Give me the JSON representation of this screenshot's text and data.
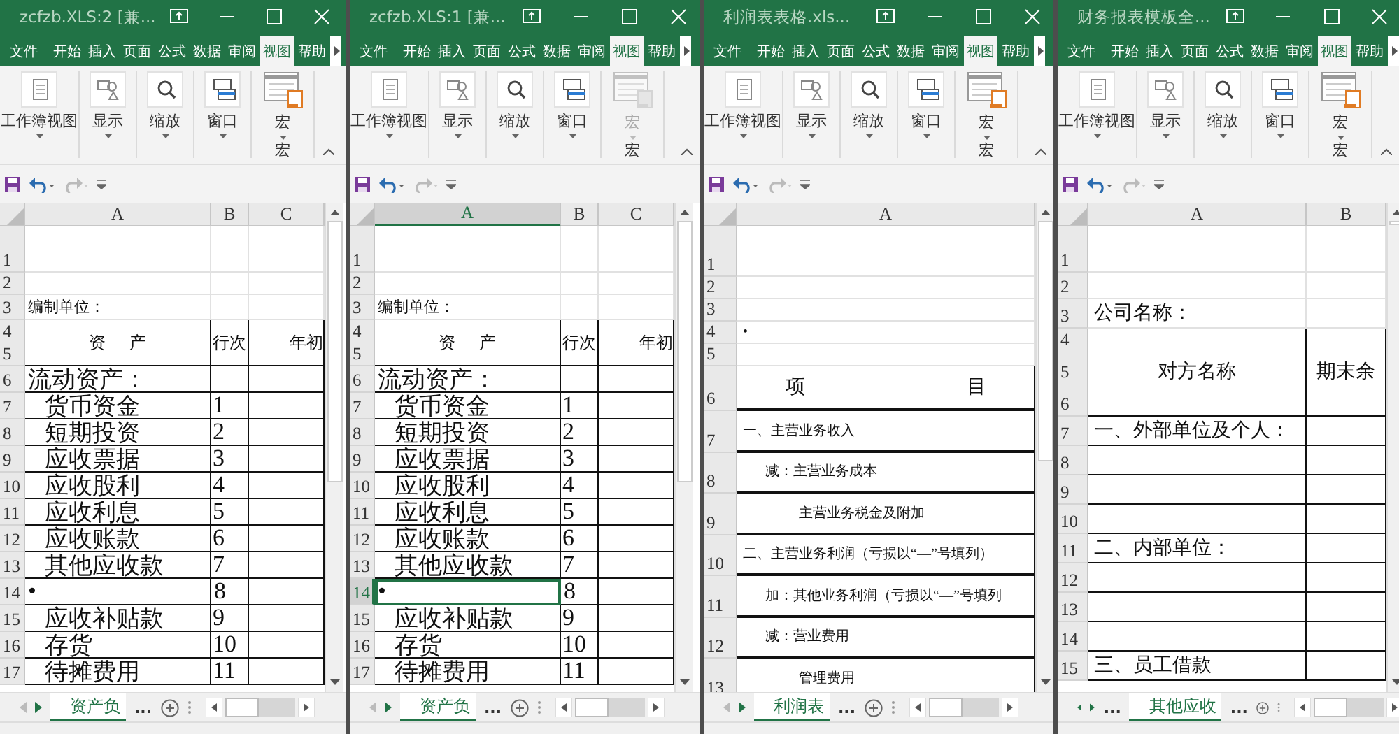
{
  "windows": [
    {
      "title": "zcfzb.XLS:2 [兼...",
      "ribbon_tabs": [
        {
          "label": "文件",
          "selected": false
        },
        {
          "label": "开始",
          "selected": false
        },
        {
          "label": "插入",
          "selected": false
        },
        {
          "label": "页面",
          "selected": false
        },
        {
          "label": "公式",
          "selected": false
        },
        {
          "label": "数据",
          "selected": false
        },
        {
          "label": "审阅",
          "selected": false
        },
        {
          "label": "视图",
          "selected": true
        },
        {
          "label": "帮助",
          "selected": false
        }
      ],
      "ribbon_groups": [
        {
          "label": "工作簿视图",
          "disabled": false
        },
        {
          "label": "显示",
          "disabled": false
        },
        {
          "label": "缩放",
          "disabled": false
        },
        {
          "label": "窗口",
          "disabled": false
        },
        {
          "label": "宏",
          "group_label": "宏",
          "disabled": false
        }
      ],
      "columns": [
        {
          "label": "A",
          "selected": false
        },
        {
          "label": "B",
          "selected": false
        },
        {
          "label": "C",
          "selected": false
        }
      ],
      "rows": [
        {
          "numbers": [
            "1"
          ],
          "kind": "blank",
          "boxed": false,
          "selected": false
        },
        {
          "numbers": [
            "2"
          ],
          "kind": "blank",
          "boxed": false,
          "selected": false
        },
        {
          "numbers": [
            "3"
          ],
          "kind": "note",
          "boxed": false,
          "selected": false,
          "cells": [
            "编制单位："
          ]
        },
        {
          "numbers": [
            "4",
            "5"
          ],
          "kind": "header",
          "boxed": true,
          "selected": false,
          "cells": [
            "资 产",
            "行次",
            "年初"
          ]
        },
        {
          "numbers": [
            "6"
          ],
          "kind": "plain",
          "boxed": true,
          "selected": false,
          "cells": [
            "流动资产："
          ]
        },
        {
          "numbers": [
            "7"
          ],
          "kind": "indent",
          "boxed": true,
          "selected": false,
          "cells": [
            "货币资金",
            "1"
          ]
        },
        {
          "numbers": [
            "8"
          ],
          "kind": "indent",
          "boxed": true,
          "selected": false,
          "cells": [
            "短期投资",
            "2"
          ]
        },
        {
          "numbers": [
            "9"
          ],
          "kind": "indent",
          "boxed": true,
          "selected": false,
          "cells": [
            "应收票据",
            "3"
          ]
        },
        {
          "numbers": [
            "10"
          ],
          "kind": "indent",
          "boxed": true,
          "selected": false,
          "cells": [
            "应收股利",
            "4"
          ]
        },
        {
          "numbers": [
            "11"
          ],
          "kind": "indent",
          "boxed": true,
          "selected": false,
          "cells": [
            "应收利息",
            "5"
          ]
        },
        {
          "numbers": [
            "12"
          ],
          "kind": "indent",
          "boxed": true,
          "selected": false,
          "cells": [
            "应收账款",
            "6"
          ]
        },
        {
          "numbers": [
            "13"
          ],
          "kind": "indent",
          "boxed": true,
          "selected": false,
          "cells": [
            "其他应收款",
            "7"
          ]
        },
        {
          "numbers": [
            "14"
          ],
          "kind": "plain",
          "boxed": true,
          "selected": false,
          "cells": [
            "•",
            "8"
          ]
        },
        {
          "numbers": [
            "15"
          ],
          "kind": "indent",
          "boxed": true,
          "selected": false,
          "cells": [
            "应收补贴款",
            "9"
          ]
        },
        {
          "numbers": [
            "16"
          ],
          "kind": "indent",
          "boxed": true,
          "selected": false,
          "cells": [
            "存货",
            "10"
          ]
        },
        {
          "numbers": [
            "17"
          ],
          "kind": "indent",
          "boxed": true,
          "selected": false,
          "cells": [
            "待摊费用",
            "11"
          ]
        }
      ],
      "sheet_bar": {
        "first_enabled": false,
        "items": [
          {
            "kind": "tab",
            "label": "资产负",
            "selected": true
          },
          {
            "kind": "more",
            "label": "..."
          }
        ]
      }
    },
    {
      "title": "zcfzb.XLS:1 [兼...",
      "ribbon_tabs": [
        {
          "label": "文件",
          "selected": false
        },
        {
          "label": "开始",
          "selected": false
        },
        {
          "label": "插入",
          "selected": false
        },
        {
          "label": "页面",
          "selected": false
        },
        {
          "label": "公式",
          "selected": false
        },
        {
          "label": "数据",
          "selected": false
        },
        {
          "label": "审阅",
          "selected": false
        },
        {
          "label": "视图",
          "selected": true
        },
        {
          "label": "帮助",
          "selected": false
        }
      ],
      "ribbon_groups": [
        {
          "label": "工作簿视图",
          "disabled": false
        },
        {
          "label": "显示",
          "disabled": false
        },
        {
          "label": "缩放",
          "disabled": false
        },
        {
          "label": "窗口",
          "disabled": false
        },
        {
          "label": "宏",
          "group_label": "宏",
          "disabled": true
        }
      ],
      "columns": [
        {
          "label": "A",
          "selected": true
        },
        {
          "label": "B",
          "selected": false
        },
        {
          "label": "C",
          "selected": false
        }
      ],
      "rows": [
        {
          "numbers": [
            "1"
          ],
          "kind": "blank",
          "boxed": false,
          "selected": false
        },
        {
          "numbers": [
            "2"
          ],
          "kind": "blank",
          "boxed": false,
          "selected": false
        },
        {
          "numbers": [
            "3"
          ],
          "kind": "note",
          "boxed": false,
          "selected": false,
          "cells": [
            "编制单位："
          ]
        },
        {
          "numbers": [
            "4",
            "5"
          ],
          "kind": "header",
          "boxed": true,
          "selected": false,
          "cells": [
            "资 产",
            "行次",
            "年初"
          ]
        },
        {
          "numbers": [
            "6"
          ],
          "kind": "plain",
          "boxed": true,
          "selected": false,
          "cells": [
            "流动资产："
          ]
        },
        {
          "numbers": [
            "7"
          ],
          "kind": "indent",
          "boxed": true,
          "selected": false,
          "cells": [
            "货币资金",
            "1"
          ]
        },
        {
          "numbers": [
            "8"
          ],
          "kind": "indent",
          "boxed": true,
          "selected": false,
          "cells": [
            "短期投资",
            "2"
          ]
        },
        {
          "numbers": [
            "9"
          ],
          "kind": "indent",
          "boxed": true,
          "selected": false,
          "cells": [
            "应收票据",
            "3"
          ]
        },
        {
          "numbers": [
            "10"
          ],
          "kind": "indent",
          "boxed": true,
          "selected": false,
          "cells": [
            "应收股利",
            "4"
          ]
        },
        {
          "numbers": [
            "11"
          ],
          "kind": "indent",
          "boxed": true,
          "selected": false,
          "cells": [
            "应收利息",
            "5"
          ]
        },
        {
          "numbers": [
            "12"
          ],
          "kind": "indent",
          "boxed": true,
          "selected": false,
          "cells": [
            "应收账款",
            "6"
          ]
        },
        {
          "numbers": [
            "13"
          ],
          "kind": "indent",
          "boxed": true,
          "selected": false,
          "cells": [
            "其他应收款",
            "7"
          ]
        },
        {
          "numbers": [
            "14"
          ],
          "kind": "plain",
          "boxed": true,
          "selected": true,
          "cells": [
            "•",
            "8"
          ]
        },
        {
          "numbers": [
            "15"
          ],
          "kind": "indent",
          "boxed": true,
          "selected": false,
          "cells": [
            "应收补贴款",
            "9"
          ]
        },
        {
          "numbers": [
            "16"
          ],
          "kind": "indent",
          "boxed": true,
          "selected": false,
          "cells": [
            "存货",
            "10"
          ]
        },
        {
          "numbers": [
            "17"
          ],
          "kind": "indent",
          "boxed": true,
          "selected": false,
          "cells": [
            "待摊费用",
            "11"
          ]
        }
      ],
      "sheet_bar": {
        "first_enabled": false,
        "items": [
          {
            "kind": "tab",
            "label": "资产负",
            "selected": true
          },
          {
            "kind": "more",
            "label": "..."
          }
        ]
      }
    },
    {
      "title": "利润表表格.xls...",
      "ribbon_tabs": [
        {
          "label": "文件",
          "selected": false
        },
        {
          "label": "开始",
          "selected": false
        },
        {
          "label": "插入",
          "selected": false
        },
        {
          "label": "页面",
          "selected": false
        },
        {
          "label": "公式",
          "selected": false
        },
        {
          "label": "数据",
          "selected": false
        },
        {
          "label": "审阅",
          "selected": false
        },
        {
          "label": "视图",
          "selected": true
        },
        {
          "label": "帮助",
          "selected": false
        }
      ],
      "ribbon_groups": [
        {
          "label": "工作簿视图",
          "disabled": false
        },
        {
          "label": "显示",
          "disabled": false
        },
        {
          "label": "缩放",
          "disabled": false
        },
        {
          "label": "窗口",
          "disabled": false
        },
        {
          "label": "宏",
          "group_label": "宏",
          "disabled": false
        }
      ],
      "columns": [
        {
          "label": "A",
          "selected": false
        }
      ],
      "rows": [
        {
          "numbers": [
            "1"
          ],
          "kind": "blank",
          "boxed": false,
          "selected": false
        },
        {
          "numbers": [
            "2"
          ],
          "kind": "blank",
          "boxed": false,
          "selected": false
        },
        {
          "numbers": [
            "3"
          ],
          "kind": "blank",
          "boxed": false,
          "selected": false
        },
        {
          "numbers": [
            "4"
          ],
          "kind": "plain",
          "boxed": false,
          "selected": false,
          "cells": [
            "•"
          ]
        },
        {
          "numbers": [
            "5"
          ],
          "kind": "blank",
          "boxed": false,
          "selected": false
        },
        {
          "numbers": [
            "6"
          ],
          "kind": "header",
          "boxed": true,
          "selected": false,
          "cells": [
            "项 目"
          ]
        },
        {
          "numbers": [
            "7"
          ],
          "kind": "plain",
          "boxed": true,
          "selected": false,
          "cells": [
            "一、主营业务收入"
          ]
        },
        {
          "numbers": [
            "8"
          ],
          "kind": "indent",
          "boxed": true,
          "selected": false,
          "cells": [
            "减：主营业务成本"
          ]
        },
        {
          "numbers": [
            "9"
          ],
          "kind": "indent2",
          "boxed": true,
          "selected": false,
          "cells": [
            "主营业务税金及附加"
          ]
        },
        {
          "numbers": [
            "10"
          ],
          "kind": "plain",
          "boxed": true,
          "selected": false,
          "cells": [
            "二、主营业务利润（亏损以“—”号填列）"
          ]
        },
        {
          "numbers": [
            "11"
          ],
          "kind": "indent",
          "boxed": true,
          "selected": false,
          "cells": [
            "加：其他业务利润（亏损以“—”号填列"
          ]
        },
        {
          "numbers": [
            "12"
          ],
          "kind": "indent",
          "boxed": true,
          "selected": false,
          "cells": [
            "减：营业费用"
          ]
        },
        {
          "numbers": [
            "13"
          ],
          "kind": "indent2",
          "boxed": true,
          "selected": false,
          "cells": [
            "管理费用"
          ]
        }
      ],
      "sheet_bar": {
        "first_enabled": false,
        "items": [
          {
            "kind": "tab",
            "label": "利润表",
            "selected": true
          },
          {
            "kind": "more",
            "label": "..."
          }
        ]
      }
    },
    {
      "title": "财务报表模板全...",
      "ribbon_tabs": [
        {
          "label": "文件",
          "selected": false
        },
        {
          "label": "开始",
          "selected": false
        },
        {
          "label": "插入",
          "selected": false
        },
        {
          "label": "页面",
          "selected": false
        },
        {
          "label": "公式",
          "selected": false
        },
        {
          "label": "数据",
          "selected": false
        },
        {
          "label": "审阅",
          "selected": false
        },
        {
          "label": "视图",
          "selected": true
        },
        {
          "label": "帮助",
          "selected": false
        }
      ],
      "ribbon_groups": [
        {
          "label": "工作簿视图",
          "disabled": false
        },
        {
          "label": "显示",
          "disabled": false
        },
        {
          "label": "缩放",
          "disabled": false
        },
        {
          "label": "窗口",
          "disabled": false
        },
        {
          "label": "宏",
          "group_label": "宏",
          "disabled": false
        }
      ],
      "columns": [
        {
          "label": "A",
          "selected": false
        },
        {
          "label": "B",
          "selected": false
        }
      ],
      "rows": [
        {
          "numbers": [
            "1"
          ],
          "kind": "blank",
          "boxed": false,
          "selected": false
        },
        {
          "numbers": [
            "2"
          ],
          "kind": "blank",
          "boxed": false,
          "selected": false
        },
        {
          "numbers": [
            "3"
          ],
          "kind": "plain",
          "boxed": false,
          "selected": false,
          "cells": [
            "公司名称："
          ]
        },
        {
          "numbers": [
            "4",
            "5",
            "6"
          ],
          "kind": "header",
          "boxed": true,
          "selected": false,
          "cells": [
            "对方名称",
            "期末余"
          ]
        },
        {
          "numbers": [
            "7"
          ],
          "kind": "plain",
          "boxed": true,
          "selected": false,
          "cells": [
            "一、外部单位及个人："
          ]
        },
        {
          "numbers": [
            "8"
          ],
          "kind": "blank",
          "boxed": true,
          "selected": false
        },
        {
          "numbers": [
            "9"
          ],
          "kind": "blank",
          "boxed": true,
          "selected": false
        },
        {
          "numbers": [
            "10"
          ],
          "kind": "blank",
          "boxed": true,
          "selected": false
        },
        {
          "numbers": [
            "11"
          ],
          "kind": "plain",
          "boxed": true,
          "selected": false,
          "cells": [
            "二、内部单位："
          ]
        },
        {
          "numbers": [
            "12"
          ],
          "kind": "blank",
          "boxed": true,
          "selected": false
        },
        {
          "numbers": [
            "13"
          ],
          "kind": "blank",
          "boxed": true,
          "selected": false
        },
        {
          "numbers": [
            "14"
          ],
          "kind": "blank",
          "boxed": true,
          "selected": false
        },
        {
          "numbers": [
            "15"
          ],
          "kind": "plain",
          "boxed": true,
          "selected": false,
          "cells": [
            "三、员工借款"
          ]
        }
      ],
      "sheet_bar": {
        "first_enabled": true,
        "items": [
          {
            "kind": "more",
            "label": "..."
          },
          {
            "kind": "tab",
            "label": "其他应收",
            "selected": true
          },
          {
            "kind": "more",
            "label": "..."
          }
        ]
      }
    }
  ]
}
